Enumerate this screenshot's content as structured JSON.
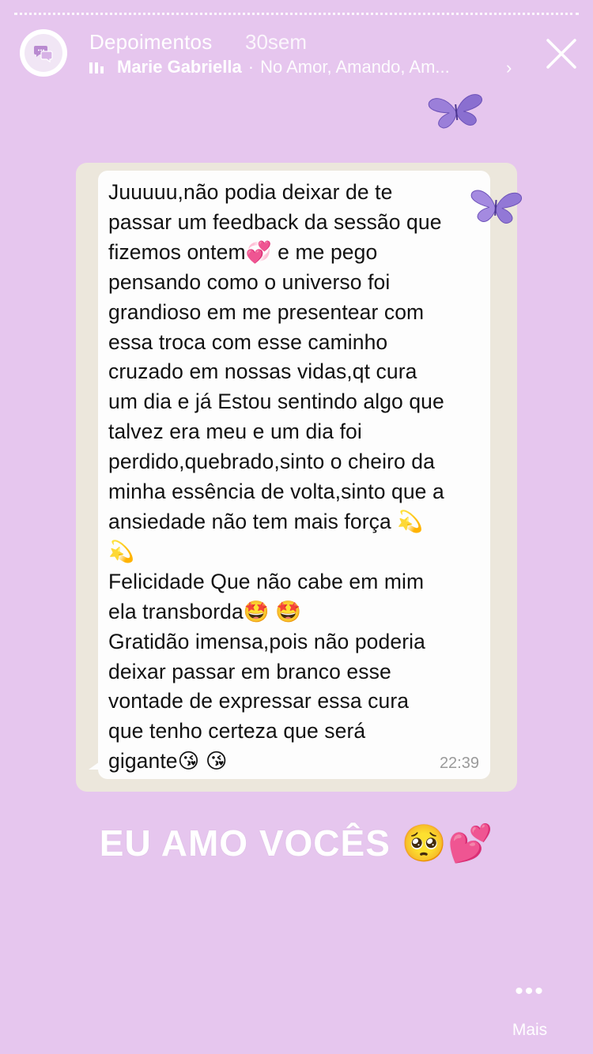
{
  "story": {
    "username": "Depoimentos",
    "time_ago": "30sem",
    "music": {
      "artist": "Marie Gabriella",
      "separator": "·",
      "song": "No Amor, Amando, Am..."
    },
    "caption": "EU AMO VOCÊS 🥺💕",
    "more_label": "Mais"
  },
  "chat_screenshot": {
    "message": "Juuuuu,não podia deixar de te\npassar um feedback da sessão que\nfizemos ontem💞 e me pego\npensando como o universo foi\ngrandioso em me presentear com\nessa troca com esse caminho\ncruzado em nossas vidas,qt cura\num dia e já Estou sentindo algo que\ntalvez era meu e um dia foi\nperdido,quebrado,sinto o cheiro da\nminha essência de volta,sinto que a\nansiedade não tem mais força 💫\n💫\nFelicidade Que não cabe em mim\nela transborda🤩 🤩\nGratidão imensa,pois não poderia\ndeixar passar em branco esse\nvontade de expressar essa cura\nque tenho certeza que será\ngigante😘 😘",
    "time": "22:39"
  },
  "icons": {
    "avatar": "chat-bubbles-icon",
    "music": "music-bars-icon",
    "chevron": "chevron-right-icon",
    "close": "close-icon",
    "more": "more-dots-icon",
    "decoration": "butterfly-icon"
  },
  "colors": {
    "background": "#e6c6ee",
    "bubble": "#fdfdfd",
    "frame": "#ece7dc",
    "butterfly": "#9b7fd9"
  }
}
